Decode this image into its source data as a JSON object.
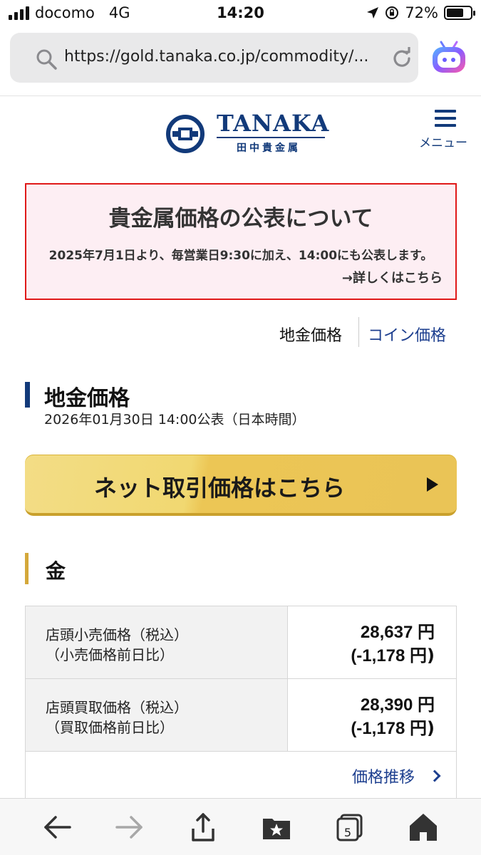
{
  "status_bar": {
    "carrier": "docomo",
    "network": "4G",
    "time": "14:20",
    "battery": "72%",
    "battery_level": 0.72
  },
  "browser": {
    "url": "https://gold.tanaka.co.jp/commodity/...",
    "tab_count": "5",
    "icons": [
      "search-icon",
      "reload-icon",
      "assistant-icon",
      "back-icon",
      "forward-icon",
      "share-icon",
      "bookmarks-icon",
      "tabs-icon",
      "home-icon"
    ]
  },
  "header": {
    "logo_text": "TANAKA",
    "logo_sub": "田中貴金属",
    "menu_label": "メニュー"
  },
  "notice": {
    "title": "貴金属価格の公表について",
    "body": "2025年7月1日より、毎営業日9:30に加え、14:00にも公表します。",
    "link": "→詳しくはこちら"
  },
  "tabs": {
    "ground": "地金価格",
    "coin": "コイン価格"
  },
  "section": {
    "title": "地金価格",
    "published": "2026年01月30日 14:00公表（日本時間）"
  },
  "net_trading": {
    "label": "ネット取引価格はこちら"
  },
  "gold": {
    "title": "金",
    "rows": [
      {
        "label_line1": "店頭小売価格（税込）",
        "label_line2": "（小売価格前日比）",
        "value": "28,637",
        "change": "(-1,178",
        "unit": "円",
        "unit_close": "円)"
      },
      {
        "label_line1": "店頭買取価格（税込）",
        "label_line2": "（買取価格前日比）",
        "value": "28,390",
        "change": "(-1,178",
        "unit": "円",
        "unit_close": "円)"
      }
    ],
    "trend_link": "価格推移"
  },
  "colors": {
    "brand_navy": "#123a7a",
    "link_blue": "#1d3f8f",
    "notice_border": "#e01919",
    "notice_bg": "#fdeef3",
    "gold_accent": "#d4a83a",
    "button_gold": "#eac456"
  }
}
